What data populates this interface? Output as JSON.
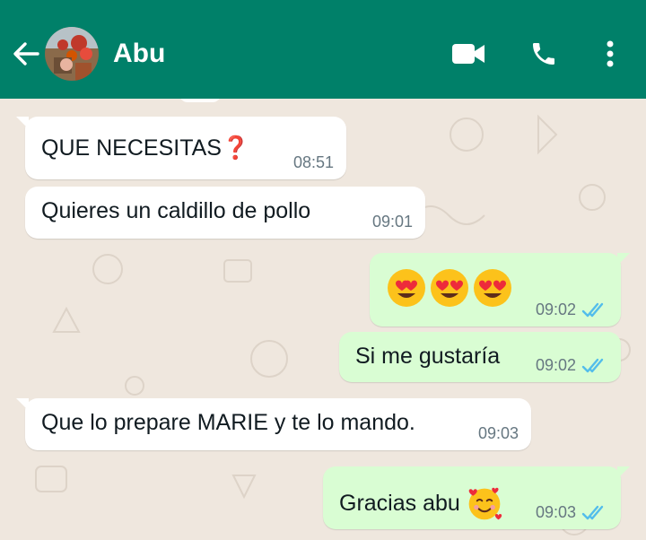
{
  "header": {
    "contact_name": "Abu",
    "icons": {
      "back": "arrow-left-icon",
      "video": "video-camera-icon",
      "call": "phone-icon",
      "menu": "more-vertical-icon"
    },
    "colors": {
      "bar": "#008069",
      "chat_bg": "#efe7de",
      "incoming": "#ffffff",
      "outgoing": "#d9fdd3",
      "read_ticks": "#53bdeb"
    }
  },
  "messages": [
    {
      "direction": "in",
      "text": "QUE NECESITAS",
      "emoji": "❓",
      "time": "08:51"
    },
    {
      "direction": "in",
      "text": "Quieres un caldillo de pollo",
      "time": "09:01"
    },
    {
      "direction": "out",
      "text": "",
      "emoji": "😍😍😍",
      "time": "09:02",
      "status": "read"
    },
    {
      "direction": "out",
      "text": "Si me gustaría",
      "time": "09:02",
      "status": "read"
    },
    {
      "direction": "in",
      "text": "Que lo prepare MARIE y te lo mando.",
      "time": "09:03"
    },
    {
      "direction": "out",
      "text": "Gracias abu",
      "emoji": "🥰",
      "time": "09:03",
      "status": "read"
    }
  ]
}
